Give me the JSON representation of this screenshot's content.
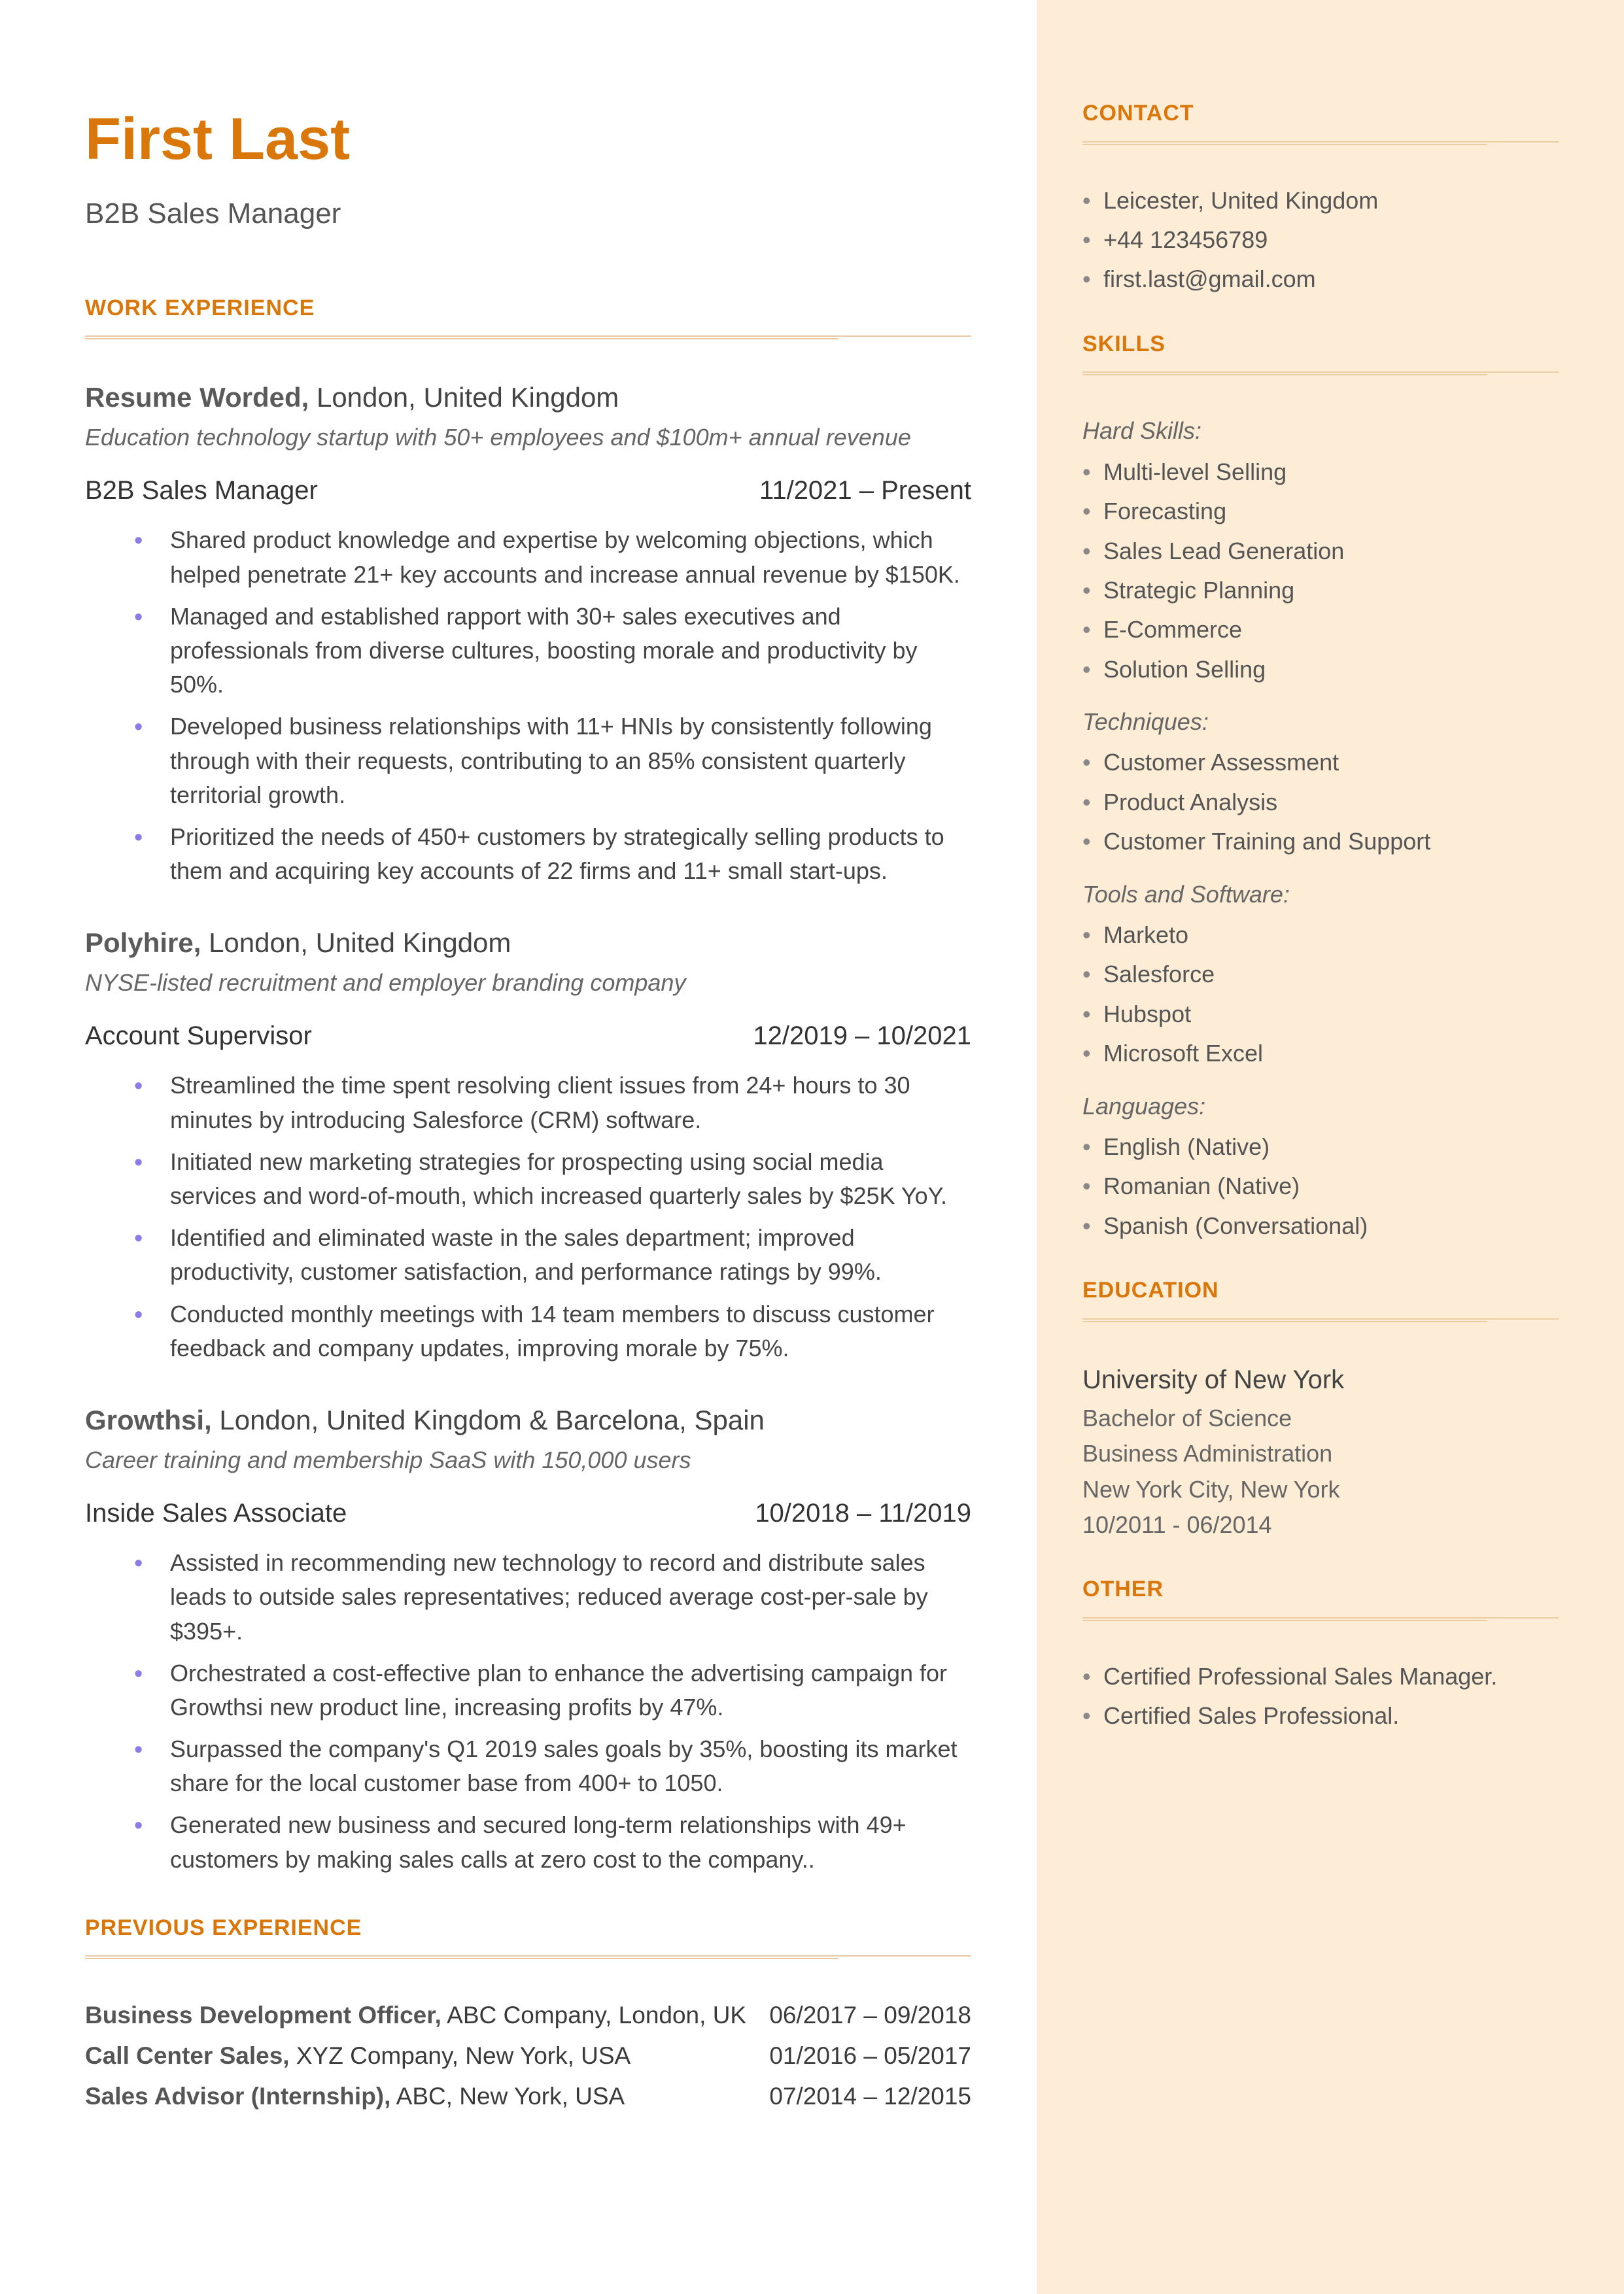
{
  "name": "First Last",
  "title": "B2B Sales Manager",
  "sections": {
    "work": "WORK EXPERIENCE",
    "prev": "PREVIOUS EXPERIENCE",
    "contact": "CONTACT",
    "skills": "SKILLS",
    "education": "EDUCATION",
    "other": "OTHER"
  },
  "jobs": [
    {
      "company": "Resume Worded,",
      "location": " London, United Kingdom",
      "desc": "Education technology startup with 50+ employees and $100m+ annual revenue",
      "role": "B2B Sales Manager",
      "dates": "11/2021 – Present",
      "bullets": [
        "Shared product knowledge and expertise by welcoming objections, which helped penetrate 21+ key accounts and increase annual revenue by $150K.",
        "Managed and established rapport with 30+ sales executives and professionals from diverse cultures, boosting morale and productivity by 50%.",
        "Developed business relationships with 11+ HNIs by consistently following through with their requests, contributing to an 85% consistent quarterly territorial growth.",
        "Prioritized the needs of 450+ customers by strategically selling products to them and acquiring key accounts of 22 firms and 11+ small start-ups."
      ]
    },
    {
      "company": "Polyhire,",
      "location": " London, United Kingdom",
      "desc": "NYSE-listed recruitment and employer branding company",
      "role": "Account Supervisor",
      "dates": "12/2019 – 10/2021",
      "bullets": [
        "Streamlined the time spent resolving client issues from 24+ hours to 30 minutes by introducing Salesforce (CRM) software.",
        "Initiated new marketing strategies for prospecting using social media services and word-of-mouth, which increased quarterly sales by $25K YoY.",
        "Identified and eliminated waste in the sales department; improved productivity, customer satisfaction, and performance ratings by 99%.",
        "Conducted monthly meetings with 14 team members to discuss customer feedback and company updates, improving morale by 75%."
      ]
    },
    {
      "company": "Growthsi,",
      "location": " London, United Kingdom & Barcelona, Spain",
      "desc": "Career training and membership SaaS with 150,000 users",
      "role": "Inside Sales Associate",
      "dates": "10/2018 – 11/2019",
      "bullets": [
        "Assisted in recommending new technology to record and distribute sales leads to outside sales representatives; reduced average cost-per-sale by $395+.",
        "Orchestrated a cost-effective plan to enhance the advertising campaign for Growthsi new product line, increasing profits by 47%.",
        "Surpassed the company's Q1 2019 sales goals by 35%, boosting its market share for the local customer base from 400+ to 1050.",
        "Generated new business and secured long-term relationships with 49+ customers by making sales calls at zero cost to the company.."
      ]
    }
  ],
  "prev": [
    {
      "role": "Business Development Officer,",
      "rest": " ABC Company, London, UK",
      "dates": "06/2017 – 09/2018"
    },
    {
      "role": "Call Center Sales,",
      "rest": " XYZ Company, New York, USA",
      "dates": "01/2016 – 05/2017"
    },
    {
      "role": "Sales Advisor (Internship),",
      "rest": " ABC, New York, USA",
      "dates": "07/2014 – 12/2015"
    }
  ],
  "contact": [
    "Leicester, United Kingdom",
    "+44 123456789",
    "first.last@gmail.com"
  ],
  "skills": {
    "hard_label": "Hard Skills:",
    "hard": [
      "Multi-level Selling",
      "Forecasting",
      "Sales Lead Generation",
      "Strategic Planning",
      "E-Commerce",
      "Solution Selling"
    ],
    "tech_label": "Techniques:",
    "tech": [
      "Customer Assessment",
      "Product Analysis",
      "Customer Training and Support"
    ],
    "tools_label": "Tools and Software:",
    "tools": [
      "Marketo",
      "Salesforce",
      "Hubspot",
      "Microsoft Excel"
    ],
    "lang_label": "Languages:",
    "lang": [
      "English (Native)",
      "Romanian (Native)",
      "Spanish (Conversational)"
    ]
  },
  "education": {
    "uni": "University of New York",
    "degree": "Bachelor of Science",
    "field": "Business Administration",
    "loc": "New York City, New York",
    "dates": "10/2011 - 06/2014"
  },
  "other": [
    "Certified Professional Sales Manager.",
    "Certified Sales Professional."
  ]
}
